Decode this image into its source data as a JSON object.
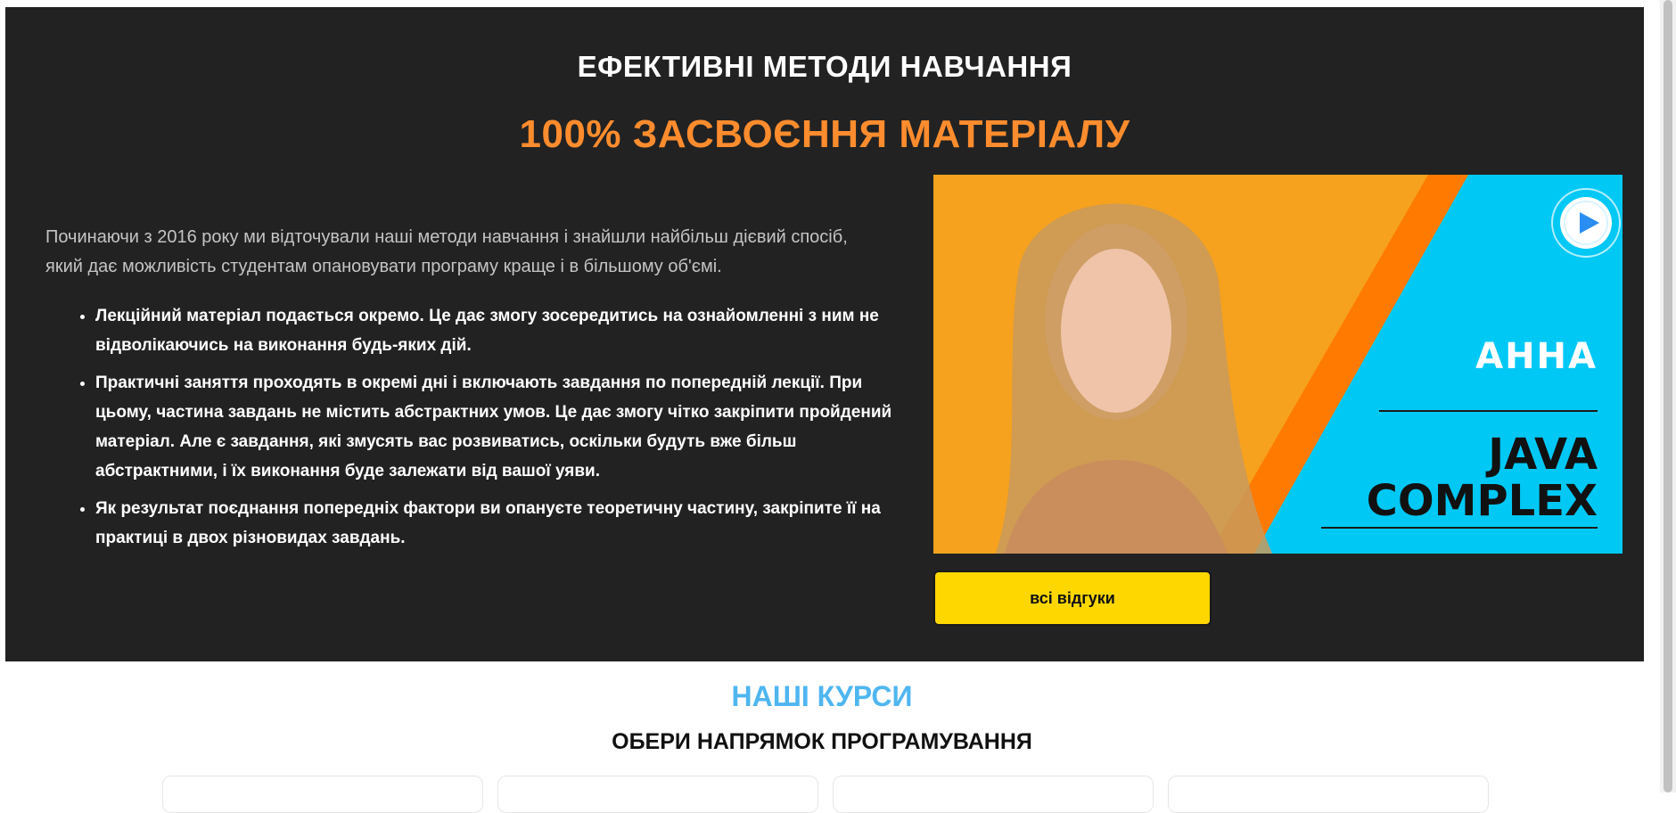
{
  "methods": {
    "title": "ЕФЕКТИВНІ МЕТОДИ НАВЧАННЯ",
    "subtitle": "100% ЗАСВОЄННЯ МАТЕРІАЛУ",
    "intro": "Починаючи з 2016 року ми відточували наші методи навчання і знайшли найбільш дієвий спосіб, який дає можливість студентам опановувати програму краще і в більшому об'ємі.",
    "bullets": [
      "Лекційний матеріал подається окремо. Це дає змогу зосередитись на ознайомленні з ним не відволікаючись на виконання будь-яких дій.",
      "Практичні заняття проходять в окремі дні і включають завдання по попередній лекції. При цьому, частина завдань не містить абстрактних умов. Це дає змогу чітко закріпити пройдений матеріал. Але є завдання, які змусять вас розвиватись, оскільки будуть вже більш абстрактними, і їх виконання буде залежати від вашої уяви.",
      "Як результат поєднання попередніх фактори ви опануєте теоретичну частину, закріпите її на практиці в двох різновидах завдань."
    ]
  },
  "video": {
    "name": "АННА",
    "course_line1": "JAVA",
    "course_line2": "COMPLEX",
    "play_icon": "play-icon"
  },
  "reviews_button": "всі відгуки",
  "courses": {
    "title": "НАШІ КУРСИ",
    "subtitle": "ОБЕРИ НАПРЯМОК ПРОГРАМУВАННЯ"
  },
  "colors": {
    "dark_bg": "#222222",
    "accent_orange": "#ff8c2e",
    "accent_yellow": "#ffd700",
    "accent_blue": "#4fb6f0",
    "video_cyan": "#00c8f5"
  }
}
